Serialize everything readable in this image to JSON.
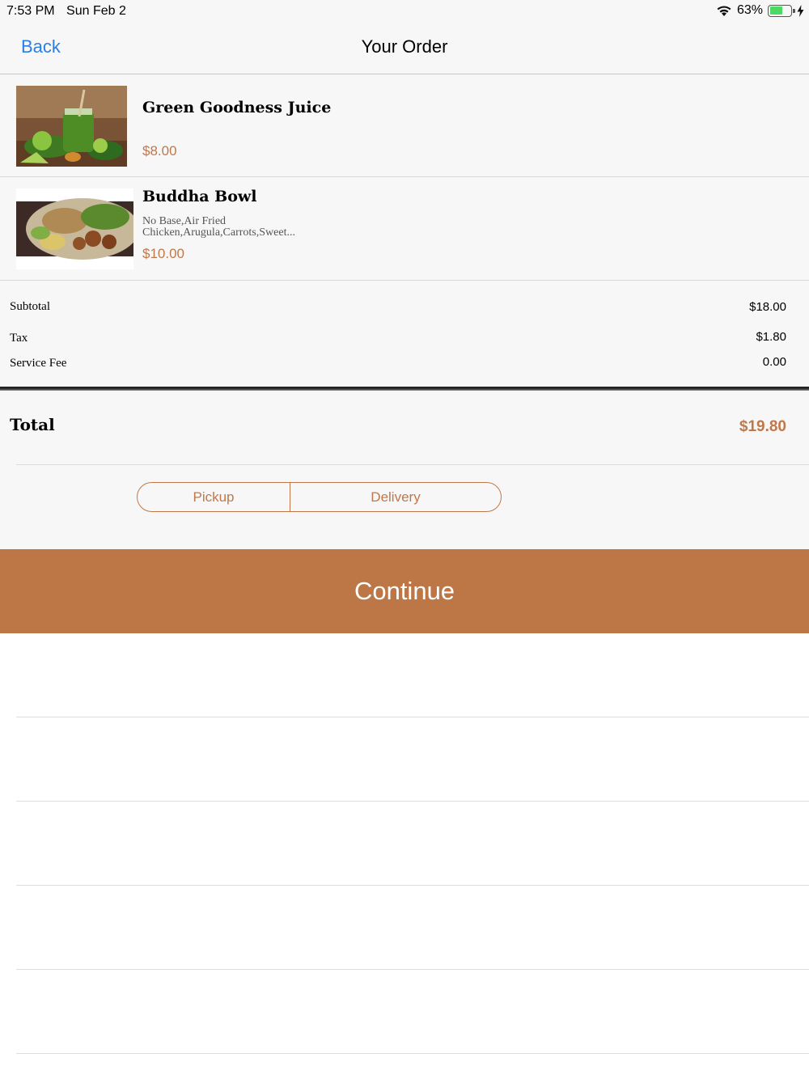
{
  "status_bar": {
    "time": "7:53 PM",
    "date": "Sun Feb 2",
    "battery_percent": "63%",
    "battery_level": 0.63,
    "icons": [
      "wifi-icon",
      "battery-icon",
      "charging-bolt-icon"
    ]
  },
  "nav": {
    "back_label": "Back",
    "title": "Your Order"
  },
  "order_items": [
    {
      "name": "Green Goodness Juice",
      "description_lines": [],
      "price": "$8.00",
      "image": "green-juice-photo"
    },
    {
      "name": "Buddha Bowl",
      "description_lines": [
        "No Base,Air Fried",
        "Chicken,Arugula,Carrots,Sweet..."
      ],
      "price": "$10.00",
      "image": "buddha-bowl-photo"
    }
  ],
  "summary": {
    "subtotal_label": "Subtotal",
    "subtotal_value": "$18.00",
    "tax_label": "Tax",
    "tax_value": "$1.80",
    "service_fee_label": "Service Fee",
    "service_fee_value": "0.00"
  },
  "total": {
    "label": "Total",
    "value": "$19.80"
  },
  "fulfillment": {
    "options": [
      "Pickup",
      "Delivery"
    ]
  },
  "continue_label": "Continue",
  "colors": {
    "accent": "#bd7747",
    "price": "#c0784a",
    "link": "#2a7fe0",
    "battery": "#4cd964"
  }
}
